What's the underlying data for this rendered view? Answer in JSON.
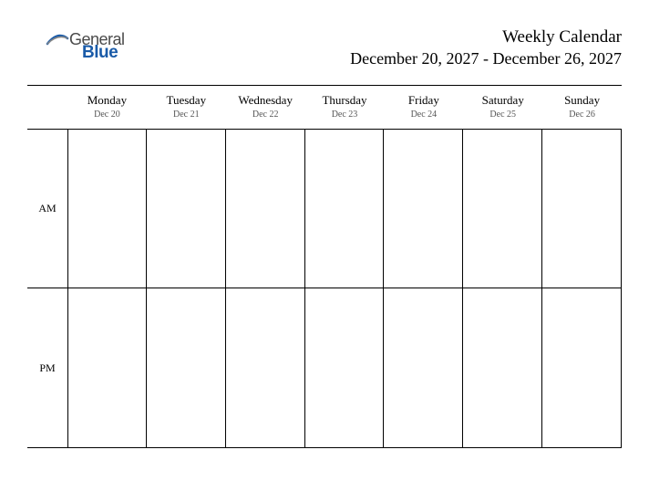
{
  "logo": {
    "text_general": "General",
    "text_blue": "Blue"
  },
  "header": {
    "title": "Weekly Calendar",
    "date_range": "December 20, 2027 - December 26, 2027"
  },
  "days": [
    {
      "name": "Monday",
      "date": "Dec 20"
    },
    {
      "name": "Tuesday",
      "date": "Dec 21"
    },
    {
      "name": "Wednesday",
      "date": "Dec 22"
    },
    {
      "name": "Thursday",
      "date": "Dec 23"
    },
    {
      "name": "Friday",
      "date": "Dec 24"
    },
    {
      "name": "Saturday",
      "date": "Dec 25"
    },
    {
      "name": "Sunday",
      "date": "Dec 26"
    }
  ],
  "time_periods": {
    "am": "AM",
    "pm": "PM"
  }
}
